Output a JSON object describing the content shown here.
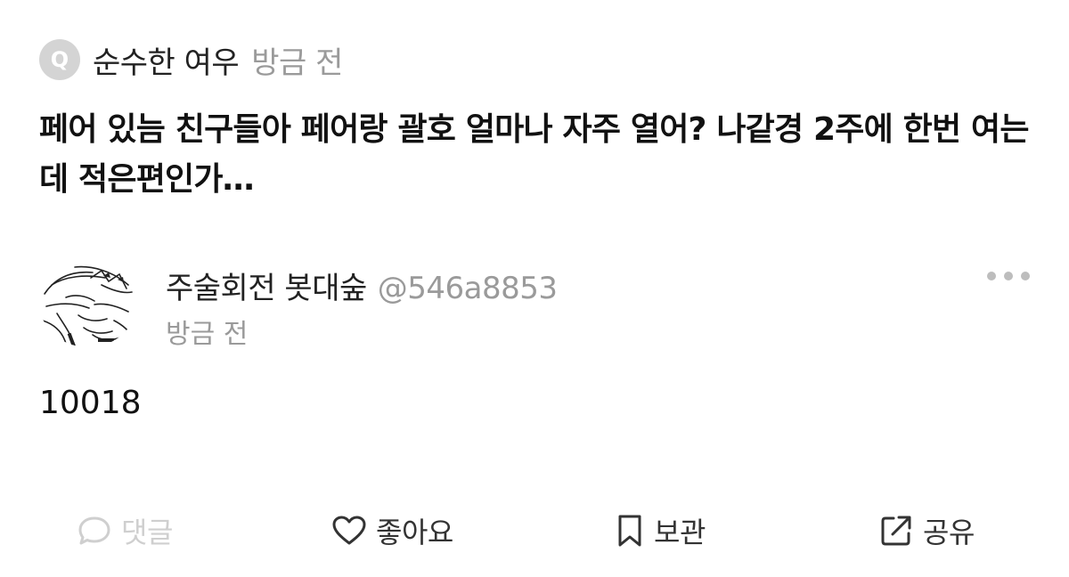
{
  "question": {
    "badge": "Q",
    "author": "순수한 여우",
    "time": "방금 전",
    "text": "페어 있늠 친구들아 페어랑 괄호 얼마나 자주 열어? 나같경 2주에 한번 여는데 적은편인가…"
  },
  "answer": {
    "author": "주술회전 봇대숲",
    "handle": "@546a8853",
    "time": "방금 전",
    "text": "10018",
    "more_icon": "more-horizontal-icon"
  },
  "actions": {
    "comment_label": "댓글",
    "like_label": "좋아요",
    "save_label": "보관",
    "share_label": "공유"
  },
  "icons": {
    "comment": "speech-bubble-icon",
    "like": "heart-icon",
    "save": "bookmark-icon",
    "share": "share-external-icon"
  },
  "colors": {
    "muted_text": "#9a9a9a",
    "disabled": "#cfcfcf",
    "badge_bg": "#d4d4d4"
  }
}
